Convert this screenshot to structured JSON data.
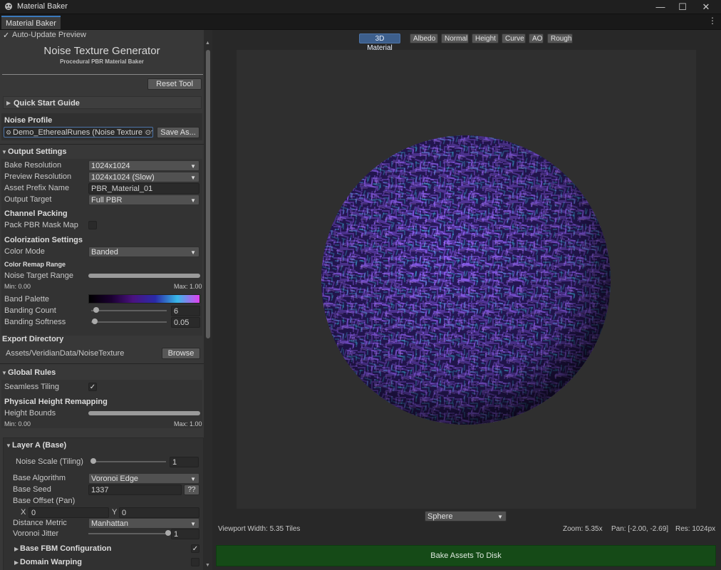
{
  "window": {
    "title": "Material Baker",
    "tab": "Material Baker"
  },
  "auto_update": {
    "label": "Auto-Update Preview",
    "checked": true
  },
  "header": {
    "title": "Noise Texture Generator",
    "subtitle": "Procedural PBR Material Baker",
    "reset_label": "Reset Tool"
  },
  "quick_start": {
    "label": "Quick Start Guide"
  },
  "profile": {
    "heading": "Noise Profile",
    "value": "Demo_EtherealRunes (Noise Texture Profi",
    "save_label": "Save As..."
  },
  "output": {
    "heading": "Output Settings",
    "bake_res_label": "Bake Resolution",
    "bake_res": "1024x1024",
    "preview_res_label": "Preview Resolution",
    "preview_res": "1024x1024 (Slow)",
    "prefix_label": "Asset Prefix Name",
    "prefix": "PBR_Material_01",
    "target_label": "Output Target",
    "target": "Full PBR"
  },
  "channel": {
    "heading": "Channel Packing",
    "pack_label": "Pack PBR Mask Map",
    "pack_checked": false
  },
  "color": {
    "heading": "Colorization Settings",
    "mode_label": "Color Mode",
    "mode": "Banded",
    "remap_heading": "Color Remap Range",
    "range_label": "Noise Target Range",
    "min_text": "Min: 0.00",
    "max_text": "Max: 1.00",
    "palette_label": "Band Palette",
    "count_label": "Banding Count",
    "count": "6",
    "count_fraction": 0.07,
    "softness_label": "Banding Softness",
    "softness": "0.05",
    "softness_fraction": 0.05,
    "palette_colors": [
      "#000000",
      "#1a0030",
      "#4a1280",
      "#2a2aa8",
      "#38b8e8",
      "#e040f0"
    ]
  },
  "export": {
    "heading": "Export Directory",
    "path": "Assets/VeridianData/NoiseTexture",
    "browse_label": "Browse"
  },
  "global": {
    "heading": "Global Rules",
    "tiling_label": "Seamless Tiling",
    "tiling_checked": true,
    "phys_heading": "Physical Height Remapping",
    "bounds_label": "Height Bounds",
    "min_text": "Min: 0.00",
    "max_text": "Max: 1.00"
  },
  "layer_a": {
    "heading": "Layer A (Base)",
    "scale_label": "Noise Scale (Tiling)",
    "scale": "1",
    "scale_fraction": 0.0,
    "algo_label": "Base Algorithm",
    "algo": "Voronoi Edge",
    "seed_label": "Base Seed",
    "seed": "1337",
    "seed_button": "??",
    "offset_label": "Base Offset (Pan)",
    "x_label": "X",
    "x": "0",
    "y_label": "Y",
    "y": "0",
    "metric_label": "Distance Metric",
    "metric": "Manhattan",
    "jitter_label": "Voronoi Jitter",
    "jitter": "1",
    "jitter_fraction": 1.0,
    "fbm_label": "Base FBM Configuration",
    "fbm_checked": true,
    "warp_label": "Domain Warping",
    "warp_checked": false
  },
  "preview": {
    "tabs": [
      "3D Material",
      "Albedo",
      "Normal",
      "Height",
      "Curve",
      "AO",
      "Rough"
    ],
    "active_tab": 0,
    "shape": "Sphere",
    "viewport_width": "Viewport Width: 5.35 Tiles",
    "zoom": "Zoom: 5.35x",
    "pan": "Pan: [-2.00, -2.69]",
    "res": "Res: 1024px",
    "bake_label": "Bake Assets To Disk"
  }
}
